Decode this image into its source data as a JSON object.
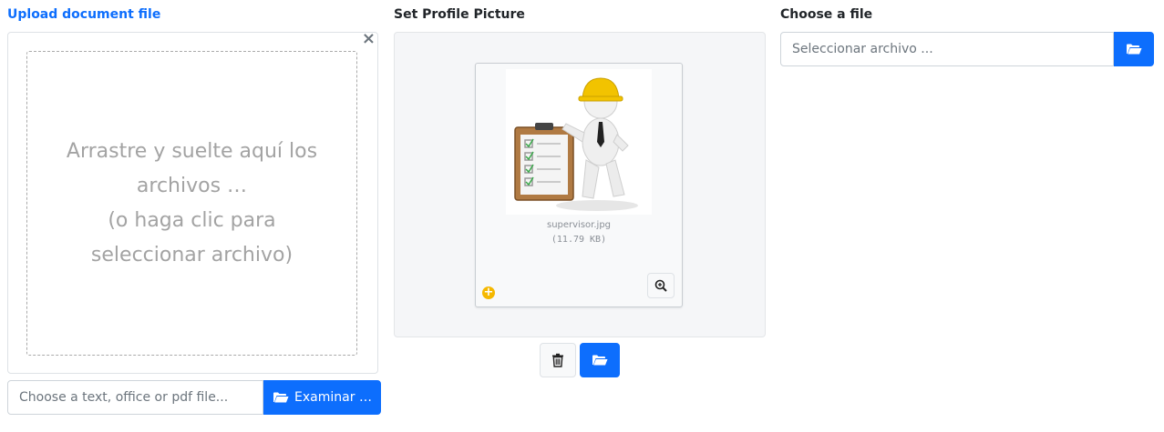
{
  "upload": {
    "label": "Upload document file",
    "close_symbol": "×",
    "dropzone_line1": "Arrastre y suelte aquí los archivos …",
    "dropzone_line2": "(o haga clic para seleccionar archivo)",
    "input_placeholder": "Choose a text, office or pdf file...",
    "browse_label": "Examinar …",
    "browse_icon": "folder-open-icon"
  },
  "profile": {
    "label": "Set Profile Picture",
    "file_name": "supervisor.jpg",
    "file_size": "(11.79 KB)",
    "add_icon": "plus-circle-icon",
    "zoom_icon": "zoom-in-icon",
    "delete_icon": "trash-icon",
    "browse_icon": "folder-open-icon"
  },
  "choose": {
    "label": "Choose a file",
    "input_placeholder": "Seleccionar archivo ...",
    "browse_icon": "folder-open-icon"
  },
  "colors": {
    "primary": "#0d6efd",
    "label_blue": "#0d6efd",
    "add_badge": "#f5b800"
  }
}
